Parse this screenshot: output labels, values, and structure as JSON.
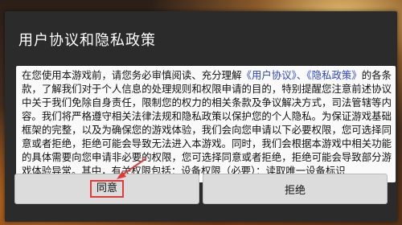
{
  "dialog": {
    "title": "用户协议和隐私政策",
    "body": {
      "intro": "在您使用本游戏前，请您务必审慎阅读、充分理解",
      "link_user_agreement": "《用户协议》",
      "sep": "、",
      "link_privacy_policy": "《隐私政策》",
      "text_rest": "的各条款，了解我们对于个人信息的处理规则和权限申请的目的，特别提醒您注意前述协议中关于我们免除自身责任，限制您的权力的相关条款及争议解决方式，司法管辖等内容。我们将严格遵守相关法律法规和隐私政策以保护您的个人隐私。为保证游戏基础框架的完整，以及为确保您的游戏体验，我们会向您申请以下必要权限，您可选择同意或者拒绝，拒绝可能会导致无法进入本游戏。同时，我们会根据本游戏中相关功能的具体需要向您申请非必要的权限，您可选择同意或者拒绝，拒绝可能会导致部分游戏体验异常。其中，有关权限包括：设备权限（必要）：读取唯一设备标识"
    },
    "buttons": {
      "agree_label": "同意",
      "decline_label": "拒绝"
    }
  },
  "colors": {
    "dialog_bg": "#2b2b2b",
    "link": "#2a45c8",
    "highlight": "#e23a3a"
  }
}
